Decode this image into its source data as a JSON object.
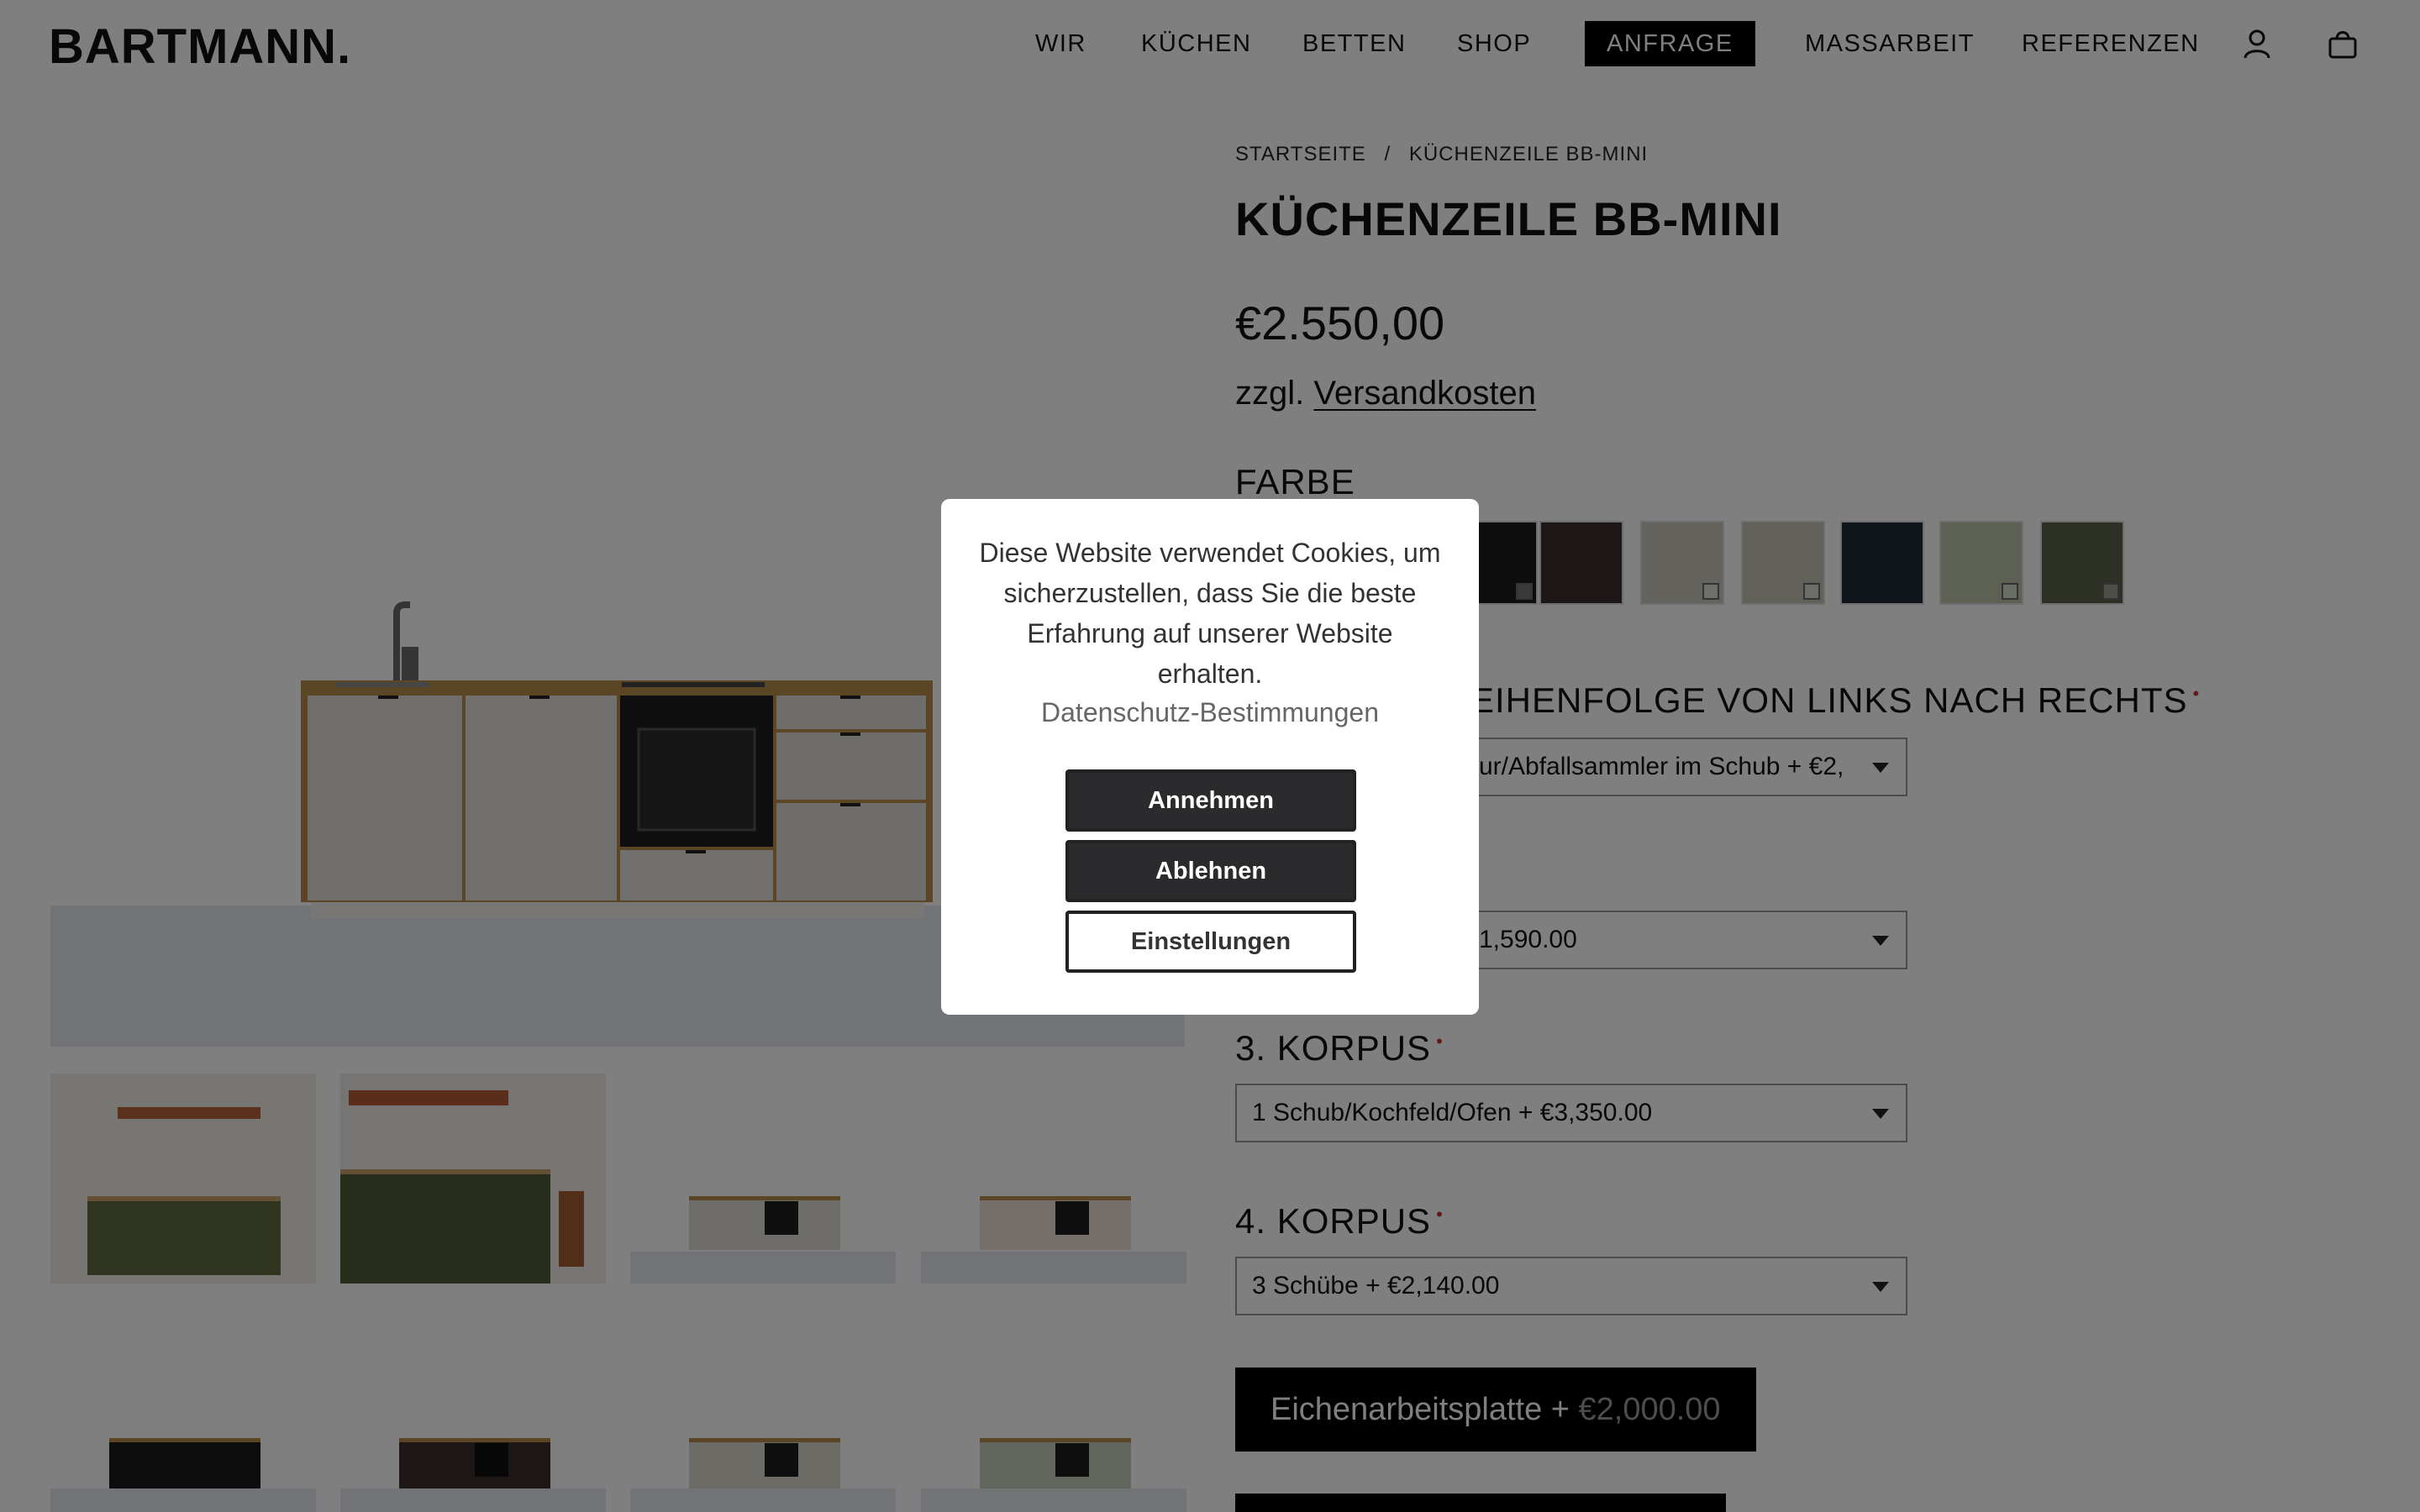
{
  "header": {
    "logo": "BARTMANN.",
    "nav": [
      "WIR",
      "KÜCHEN",
      "BETTEN",
      "SHOP",
      "ANFRAGE",
      "MASSARBEIT",
      "REFERENZEN"
    ],
    "active_nav": "ANFRAGE",
    "icons": [
      "user-icon",
      "bag-icon"
    ]
  },
  "breadcrumb": {
    "home": "STARTSEITE",
    "separator": "/",
    "current": "KÜCHENZEILE BB-MINI"
  },
  "product": {
    "title": "KÜCHENZEILE BB-MINI",
    "price": "€2.550,00",
    "shipping_prefix": "zzgl.",
    "shipping_link": "Versandkosten"
  },
  "color_section": {
    "label": "FARBE",
    "swatches": [
      "#1a1a1a",
      "#3b2f2f",
      "#c8c6bb",
      "#c2c0b3",
      "#1f2b36",
      "#b8c2a8",
      "#58604a"
    ]
  },
  "order_section": {
    "label": "EIHENFOLGE VON LINKS NACH RECHTS",
    "required_marker": "•"
  },
  "selects": {
    "first": "ur/Abfallsammler im Schub  + €2,",
    "second": "1,590.00",
    "third_label": "3. KORPUS",
    "third_value": "1 Schub/Kochfeld/Ofen  + €3,350.00",
    "fourth_label": "4. KORPUS",
    "fourth_value": "3 Schübe  + €2,140.00"
  },
  "addon": {
    "label": "Eichenarbeitsplatte +",
    "price": "€2,000.00"
  },
  "cookie_modal": {
    "text": "Diese Website verwendet Cookies, um sicherzustellen, dass Sie die beste Erfahrung auf unserer Website erhalten.",
    "privacy_link": "Datenschutz-Bestimmungen",
    "accept": "Annehmen",
    "decline": "Ablehnen",
    "settings": "Einstellungen"
  },
  "colors": {
    "overlay": "rgba(0,0,0,0.5)",
    "required": "#c0392b",
    "button_dark": "#2b2b2d"
  }
}
